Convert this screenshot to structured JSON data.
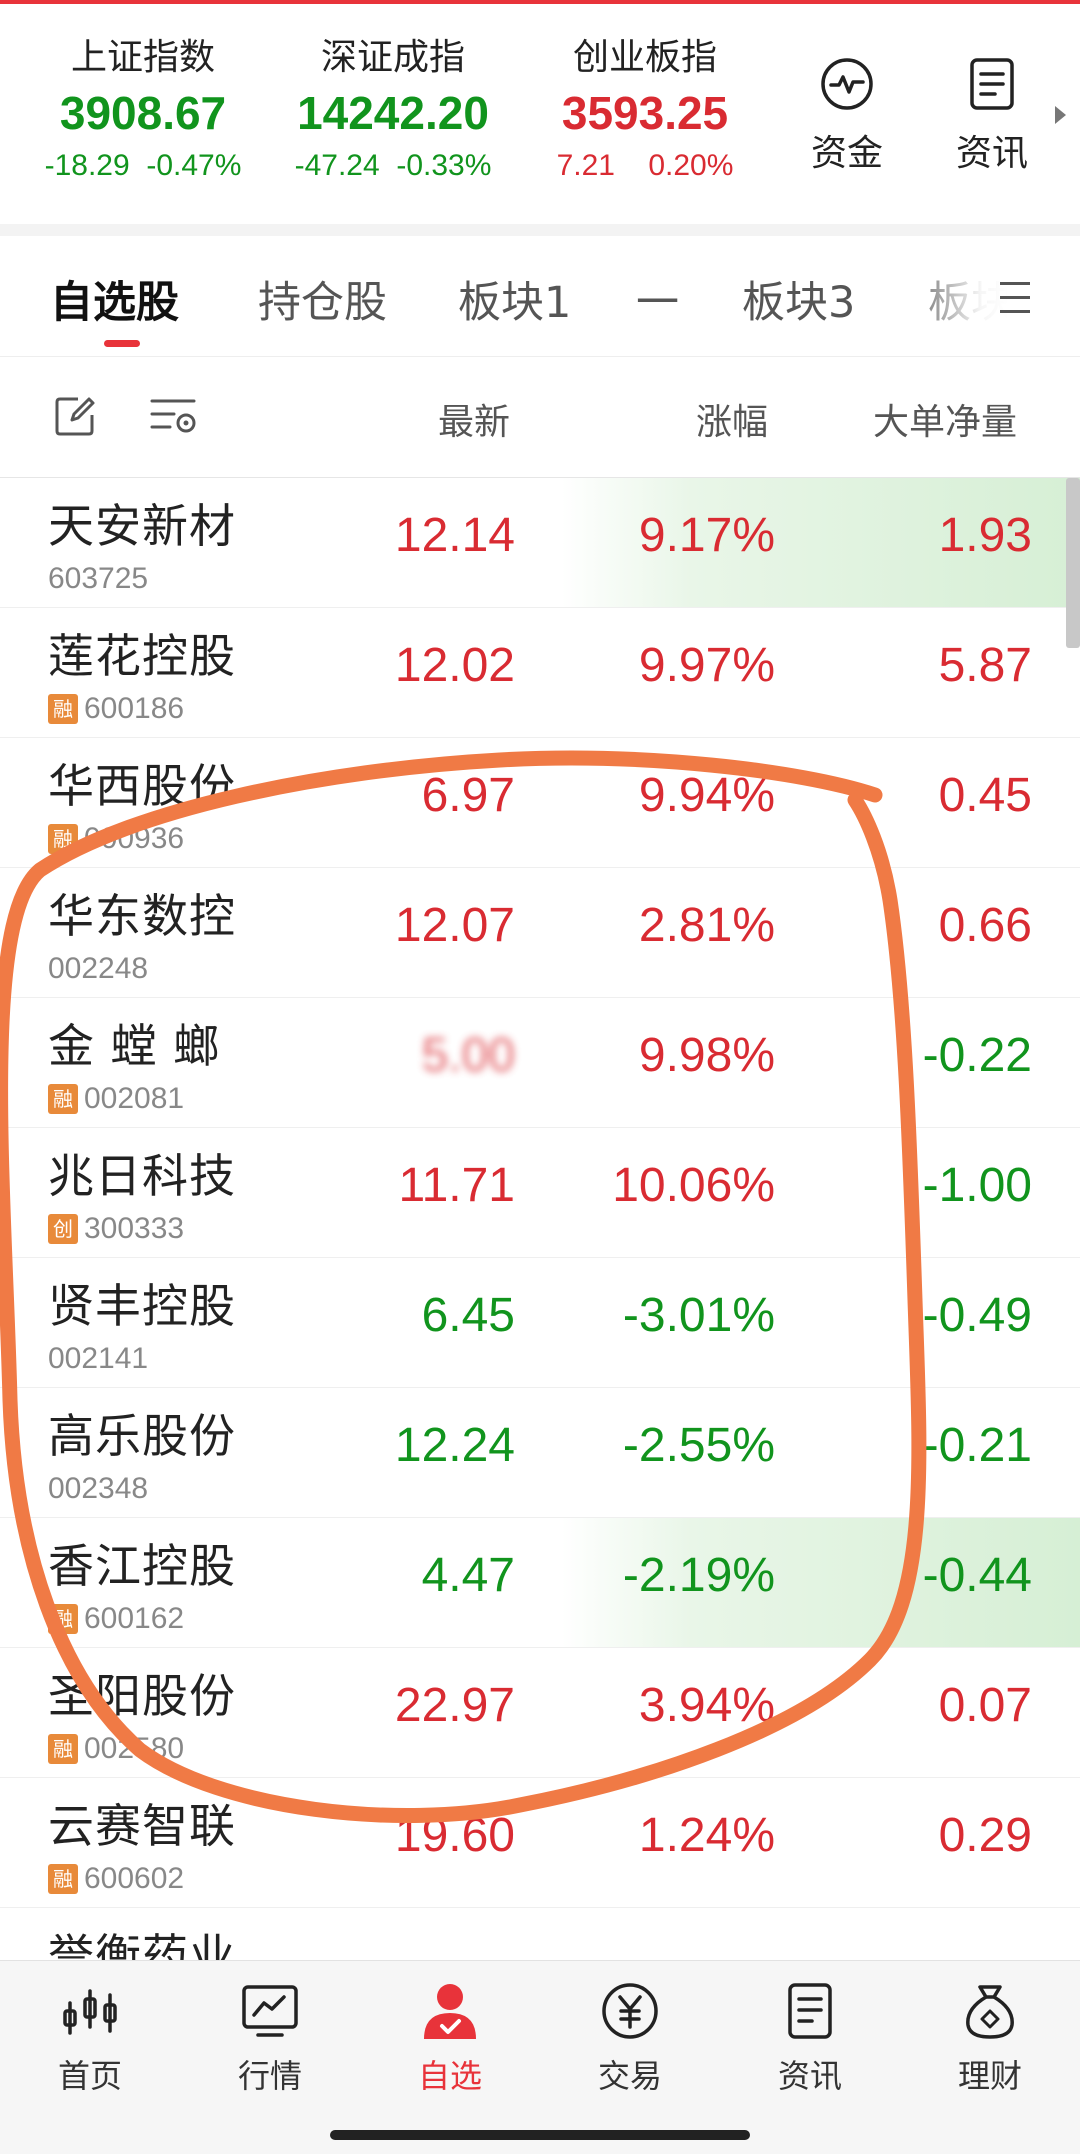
{
  "indices": [
    {
      "name": "上证指数",
      "price": "3908.67",
      "change": "-18.29",
      "percent": "-0.47%",
      "trend": "down"
    },
    {
      "name": "深证成指",
      "price": "14242.20",
      "change": "-47.24",
      "percent": "-0.33%",
      "trend": "down"
    },
    {
      "name": "创业板指",
      "price": "3593.25",
      "change": "7.21",
      "percent": "0.20%",
      "trend": "up"
    }
  ],
  "header_buttons": {
    "funds_label": "资金",
    "news_label": "资讯",
    "funds_icon": "pulse-icon",
    "news_icon": "document-icon"
  },
  "tabs": [
    "自选股",
    "持仓股",
    "板块1",
    "一",
    "板块3",
    "板块"
  ],
  "columns": {
    "latest": "最新",
    "change": "涨幅",
    "net": "大单净量"
  },
  "stocks": [
    {
      "name": "天安新材",
      "code": "603725",
      "tag": "",
      "latest": "12.14",
      "change": "9.17%",
      "net": "1.93"
    },
    {
      "name": "莲花控股",
      "code": "600186",
      "tag": "融",
      "latest": "12.02",
      "change": "9.97%",
      "net": "5.87"
    },
    {
      "name": "华西股份",
      "code": "000936",
      "tag": "融",
      "latest": "6.97",
      "change": "9.94%",
      "net": "0.45"
    },
    {
      "name": "华东数控",
      "code": "002248",
      "tag": "",
      "latest": "12.07",
      "change": "2.81%",
      "net": "0.66"
    },
    {
      "name": "金 螳 螂",
      "code": "002081",
      "tag": "融",
      "latest": "5.00",
      "change": "9.98%",
      "net": "-0.22"
    },
    {
      "name": "兆日科技",
      "code": "300333",
      "tag": "创",
      "latest": "11.71",
      "change": "10.06%",
      "net": "-1.00"
    },
    {
      "name": "贤丰控股",
      "code": "002141",
      "tag": "",
      "latest": "6.45",
      "change": "-3.01%",
      "net": "-0.49"
    },
    {
      "name": "高乐股份",
      "code": "002348",
      "tag": "",
      "latest": "12.24",
      "change": "-2.55%",
      "net": "-0.21"
    },
    {
      "name": "香江控股",
      "code": "600162",
      "tag": "融",
      "latest": "4.47",
      "change": "-2.19%",
      "net": "-0.44"
    },
    {
      "name": "圣阳股份",
      "code": "002580",
      "tag": "融",
      "latest": "22.97",
      "change": "3.94%",
      "net": "0.07"
    },
    {
      "name": "云赛智联",
      "code": "600602",
      "tag": "融",
      "latest": "19.60",
      "change": "1.24%",
      "net": "0.29"
    },
    {
      "name": "誉衡药业",
      "code": "",
      "tag": "",
      "latest": "",
      "change": "",
      "net": ""
    }
  ],
  "bottom_nav": [
    {
      "label": "首页",
      "icon": "candlestick-icon"
    },
    {
      "label": "行情",
      "icon": "chart-icon"
    },
    {
      "label": "自选",
      "icon": "user-check-icon"
    },
    {
      "label": "交易",
      "icon": "yuan-icon"
    },
    {
      "label": "资讯",
      "icon": "document-icon"
    },
    {
      "label": "理财",
      "icon": "money-bag-icon"
    }
  ],
  "colors": {
    "up": "#d92b32",
    "down": "#11941d",
    "accent": "#e8333a",
    "tag": "#e88a3a",
    "annotation": "#f07a45"
  }
}
